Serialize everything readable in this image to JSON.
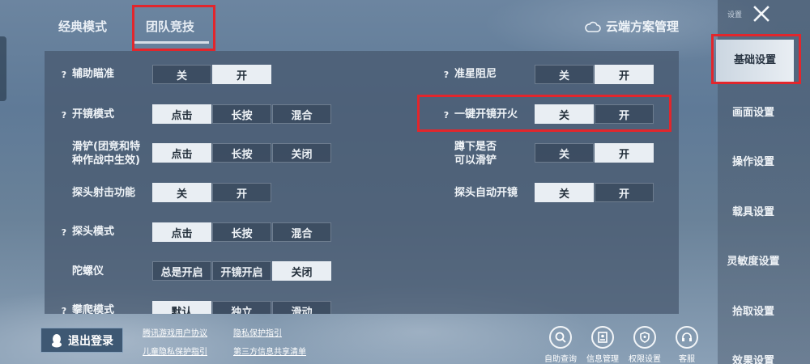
{
  "tabs": [
    {
      "label": "经典模式"
    },
    {
      "label": "团队竞技"
    }
  ],
  "cloud_manager": {
    "label": "云端方案管理",
    "icon": "cloud-icon"
  },
  "left_settings": [
    {
      "label": "辅助瞄准",
      "help": "?",
      "options": [
        "关",
        "开"
      ],
      "selected": "开"
    },
    {
      "label": "开镜模式",
      "help": "?",
      "options": [
        "点击",
        "长按",
        "混合"
      ],
      "selected": "点击"
    },
    {
      "label_line1": "滑铲(团竞和特",
      "label_line2": "种作战中生效)",
      "options": [
        "点击",
        "长按",
        "关闭"
      ],
      "selected": "点击"
    },
    {
      "label": "探头射击功能",
      "options": [
        "关",
        "开"
      ],
      "selected": "关"
    },
    {
      "label": "探头模式",
      "help": "?",
      "options": [
        "点击",
        "长按",
        "混合"
      ],
      "selected": "点击"
    },
    {
      "label": "陀螺仪",
      "options": [
        "总是开启",
        "开镜开启",
        "关闭"
      ],
      "selected": "关闭"
    },
    {
      "label": "攀爬模式",
      "help": "?",
      "options": [
        "默认",
        "独立",
        "滑动"
      ],
      "selected": "默认"
    }
  ],
  "right_settings": [
    {
      "label": "准星阻尼",
      "help": "?",
      "options": [
        "关",
        "开"
      ],
      "selected": "开"
    },
    {
      "label": "一键开镜开火",
      "help": "?",
      "options": [
        "关",
        "开"
      ],
      "selected": "关"
    },
    {
      "label_line1": "蹲下是否",
      "label_line2": "可以滑铲",
      "options": [
        "关",
        "开"
      ],
      "selected": "开"
    },
    {
      "label": "探头自动开镜",
      "options": [
        "关",
        "开"
      ],
      "selected": "关"
    }
  ],
  "sidebar": {
    "title": "设置",
    "items": [
      {
        "label": "基础设置",
        "active": true
      },
      {
        "label": "画面设置"
      },
      {
        "label": "操作设置"
      },
      {
        "label": "载具设置"
      },
      {
        "label": "灵敏度设置"
      },
      {
        "label": "拾取设置"
      },
      {
        "label": "效果设置"
      }
    ]
  },
  "footer": {
    "logout_label": "退出登录",
    "links": [
      "腾讯游戏用户协议",
      "隐私保护指引",
      "儿童隐私保护指引",
      "第三方信息共享清单"
    ],
    "buttons": [
      {
        "label": "自助查询",
        "icon": "search-icon"
      },
      {
        "label": "信息管理",
        "icon": "id-card-icon"
      },
      {
        "label": "权限设置",
        "icon": "shield-icon"
      },
      {
        "label": "客服",
        "icon": "headset-icon"
      }
    ]
  },
  "colors": {
    "highlight_box": "#e2262c",
    "selected_option": "#e9eef3"
  }
}
